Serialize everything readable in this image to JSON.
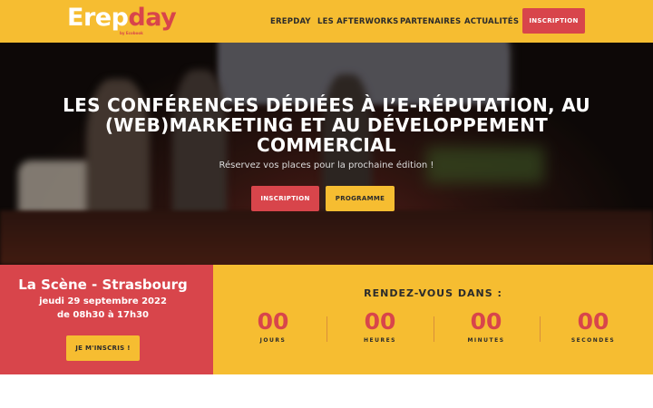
{
  "nav": {
    "logo_part1": "Erep",
    "logo_part2": "day",
    "logo_sub": "by Ecobook",
    "items": [
      {
        "label": "EREPDAY"
      },
      {
        "label": "LES AFTERWORKS"
      },
      {
        "label": "PARTENAIRES"
      },
      {
        "label": "ACTUALITÉS"
      }
    ],
    "cta_label": "INSCRIPTION"
  },
  "hero": {
    "title": "LES CONFÉRENCES DÉDIÉES À L’E-RÉPUTATION, AU (WEB)MARKETING ET AU DÉVELOPPEMENT COMMERCIAL",
    "subtitle": "Réservez vos places pour la prochaine édition !",
    "btn_inscription": "INSCRIPTION",
    "btn_programme": "PROGRAMME"
  },
  "event": {
    "venue": "La Scène - Strasbourg",
    "date": "jeudi 29 septembre 2022",
    "time": "de 08h30 à 17h30",
    "cta_label": "JE M'INSCRIS !"
  },
  "countdown": {
    "title": "Rendez-vous dans :",
    "units": [
      {
        "value": "00",
        "label": "JOURS"
      },
      {
        "value": "00",
        "label": "HEURES"
      },
      {
        "value": "00",
        "label": "MINUTES"
      },
      {
        "value": "00",
        "label": "SECONDES"
      }
    ]
  },
  "colors": {
    "brand_yellow": "#f6bd31",
    "brand_red": "#d8454b",
    "text_dark": "#2b2b2b"
  }
}
